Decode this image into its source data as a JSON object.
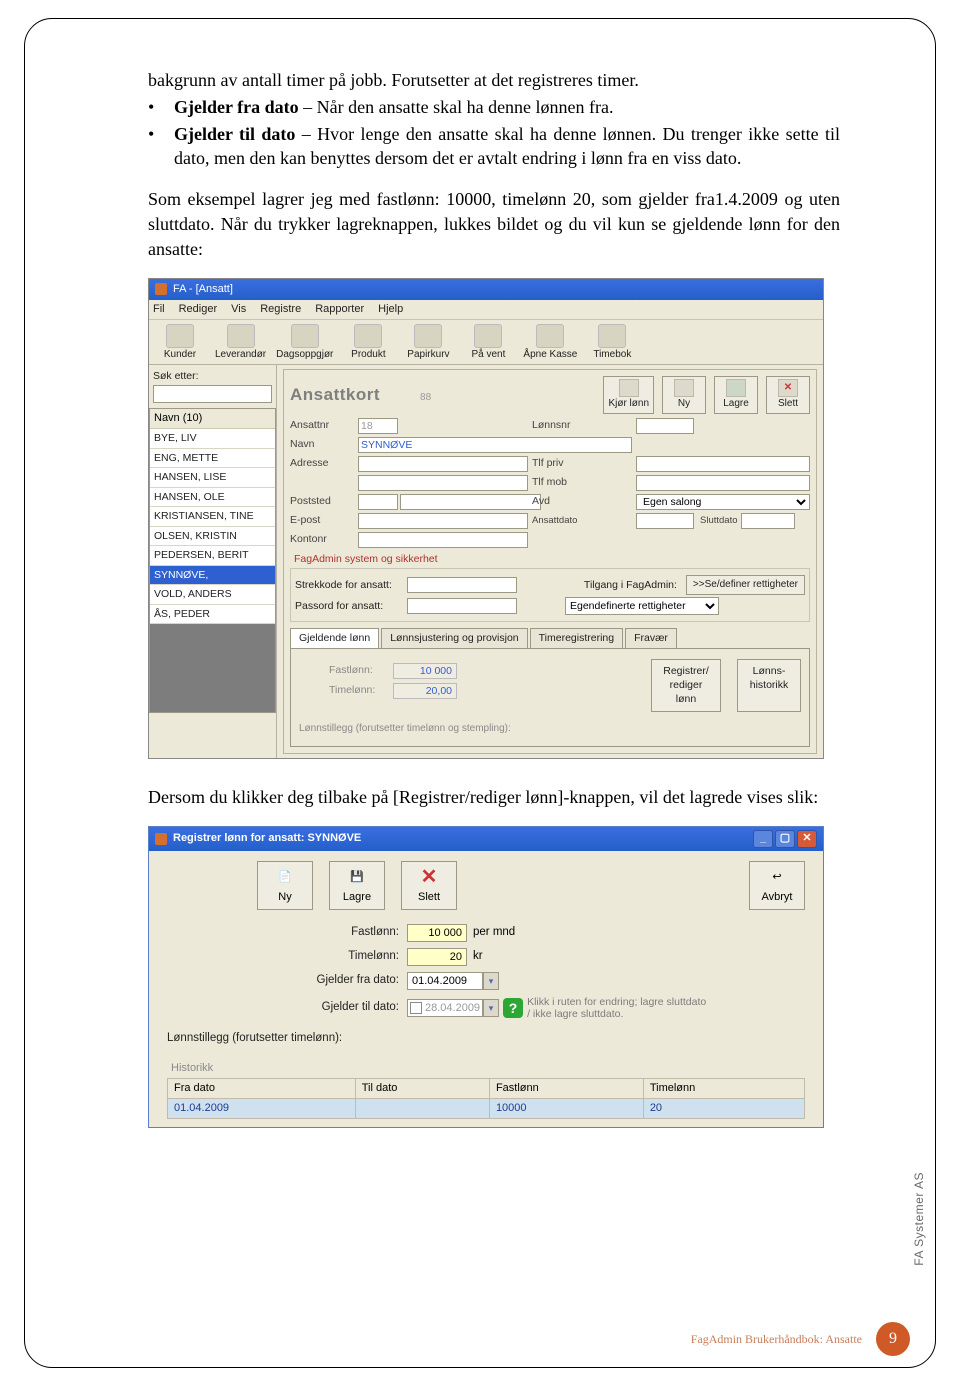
{
  "doc": {
    "intro": "bakgrunn av antall timer på jobb. Forutsetter at det registreres timer.",
    "bullet1_label": "Gjelder fra dato",
    "bullet1_text": " – Når den ansatte skal ha denne lønnen fra.",
    "bullet2_label": "Gjelder til dato",
    "bullet2_text": " – Hvor lenge den ansatte skal ha denne lønnen. Du trenger ikke sette til dato, men den kan benyttes dersom det er avtalt endring i lønn fra en viss dato.",
    "para2": "Som eksempel lagrer jeg med fastlønn: 10000, timelønn 20, som gjelder fra1.4.2009 og uten sluttdato. Når du trykker lagreknappen, lukkes bildet og du vil kun se gjeldende lønn for den ansatte:",
    "para3": "Dersom du klikker deg tilbake på [Registrer/rediger lønn]-knappen, vil det lagrede vises slik:"
  },
  "ss1": {
    "title": "FA - [Ansatt]",
    "menu": [
      "Fil",
      "Rediger",
      "Vis",
      "Registre",
      "Rapporter",
      "Hjelp"
    ],
    "toolbar": [
      "Kunder",
      "Leverandør",
      "Dagsoppgjør",
      "Produkt",
      "Papirkurv",
      "På vent",
      "Åpne Kasse",
      "Timebok"
    ],
    "search_label": "Søk etter:",
    "list_header": "Navn (10)",
    "list": [
      "BYE, LIV",
      "ENG, METTE",
      "HANSEN, LISE",
      "HANSEN, OLE",
      "KRISTIANSEN, TINE",
      "OLSEN, KRISTIN",
      "PEDERSEN, BERIT",
      "SYNNØVE,",
      "VOLD, ANDERS",
      "ÅS, PEDER"
    ],
    "card_title": "Ansattkort",
    "card_id": "88",
    "btns": {
      "kjor": "Kjør lønn",
      "ny": "Ny",
      "lagre": "Lagre",
      "slett": "Slett"
    },
    "fields": {
      "ansattnr": "Ansattnr",
      "ansattnr_val": "18",
      "lonnsnr": "Lønnsnr",
      "navn": "Navn",
      "navn_val": "SYNNØVE",
      "adresse": "Adresse",
      "tlfpriv": "Tlf priv",
      "tlfmob": "Tlf mob",
      "poststed": "Poststed",
      "avd": "Avd",
      "avd_val": "Egen salong",
      "epost": "E-post",
      "ansattdato": "Ansattdato",
      "sluttdato": "Sluttdato",
      "kontonr": "Kontonr"
    },
    "sec_title": "FagAdmin system og sikkerhet",
    "sec": {
      "strekkode": "Strekkode for ansatt:",
      "passord": "Passord for ansatt:",
      "tilgang": "Tilgang i FagAdmin:",
      "tilgang_val": "Egendefinerte rettigheter",
      "definer": ">>Se/definer rettigheter"
    },
    "tabs": [
      "Gjeldende lønn",
      "Lønnsjustering og provisjon",
      "Timeregistrering",
      "Fravær"
    ],
    "panel": {
      "fastlonn": "Fastlønn:",
      "fastlonn_val": "10 000",
      "timelonn": "Timelønn:",
      "timelonn_val": "20,00",
      "reg": "Registrer/\nrediger lønn",
      "hist": "Lønns-\nhistorikk",
      "hint": "Lønnstillegg (forutsetter timelønn og stempling):"
    }
  },
  "ss2": {
    "title": "Registrer lønn for ansatt:  SYNNØVE",
    "btns": {
      "ny": "Ny",
      "lagre": "Lagre",
      "slett": "Slett",
      "avbryt": "Avbryt"
    },
    "fields": {
      "fastlonn": "Fastlønn:",
      "fastlonn_val": "10 000",
      "fastlonn_unit": "per mnd",
      "timelonn": "Timelønn:",
      "timelonn_val": "20",
      "timelonn_unit": "kr",
      "fradato": "Gjelder fra dato:",
      "fradato_val": "01.04.2009",
      "tildato": "Gjelder til dato:",
      "tildato_val": "28.04.2009",
      "help": "Klikk i ruten for endring; lagre sluttdato / ikke lagre sluttdato.",
      "lonnstillegg": "Lønnstillegg (forutsetter timelønn):"
    },
    "hist_title": "Historikk",
    "hist_cols": [
      "Fra dato",
      "Til dato",
      "Fastlønn",
      "Timelønn"
    ],
    "hist_row": [
      "01.04.2009",
      "",
      "10000",
      "20"
    ]
  },
  "footer": {
    "label": "FagAdmin Brukerhåndbok: Ansatte",
    "page": "9",
    "side": "FA Systemer AS"
  }
}
